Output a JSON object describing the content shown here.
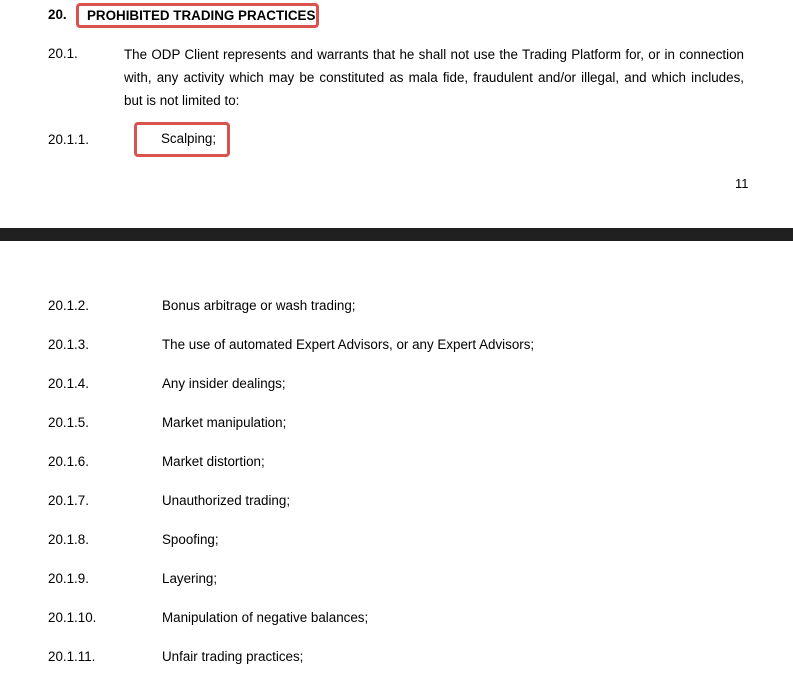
{
  "section": {
    "number": "20.",
    "title": "PROHIBITED TRADING PRACTICES"
  },
  "clause": {
    "number": "20.1.",
    "text": "The ODP Client represents and warrants that he shall not use the Trading Platform for, or in connection with, any activity which may be constituted as mala fide, fraudulent and/or illegal, and which includes, but is not limited to:"
  },
  "items": [
    {
      "number": "20.1.1.",
      "text": "Scalping;"
    },
    {
      "number": "20.1.2.",
      "text": "Bonus arbitrage or wash trading;"
    },
    {
      "number": "20.1.3.",
      "text": "The use of automated Expert Advisors, or any Expert Advisors;"
    },
    {
      "number": "20.1.4.",
      "text": "Any insider dealings;"
    },
    {
      "number": "20.1.5.",
      "text": "Market manipulation;"
    },
    {
      "number": "20.1.6.",
      "text": "Market distortion;"
    },
    {
      "number": "20.1.7.",
      "text": "Unauthorized trading;"
    },
    {
      "number": "20.1.8.",
      "text": "Spoofing;"
    },
    {
      "number": "20.1.9.",
      "text": "Layering;"
    },
    {
      "number": "20.1.10.",
      "text": "Manipulation of negative balances;"
    },
    {
      "number": "20.1.11.",
      "text": "Unfair trading practices;"
    }
  ],
  "page_number": "11",
  "colors": {
    "highlight_border": "#d9534f",
    "page_separator": "#202020"
  }
}
